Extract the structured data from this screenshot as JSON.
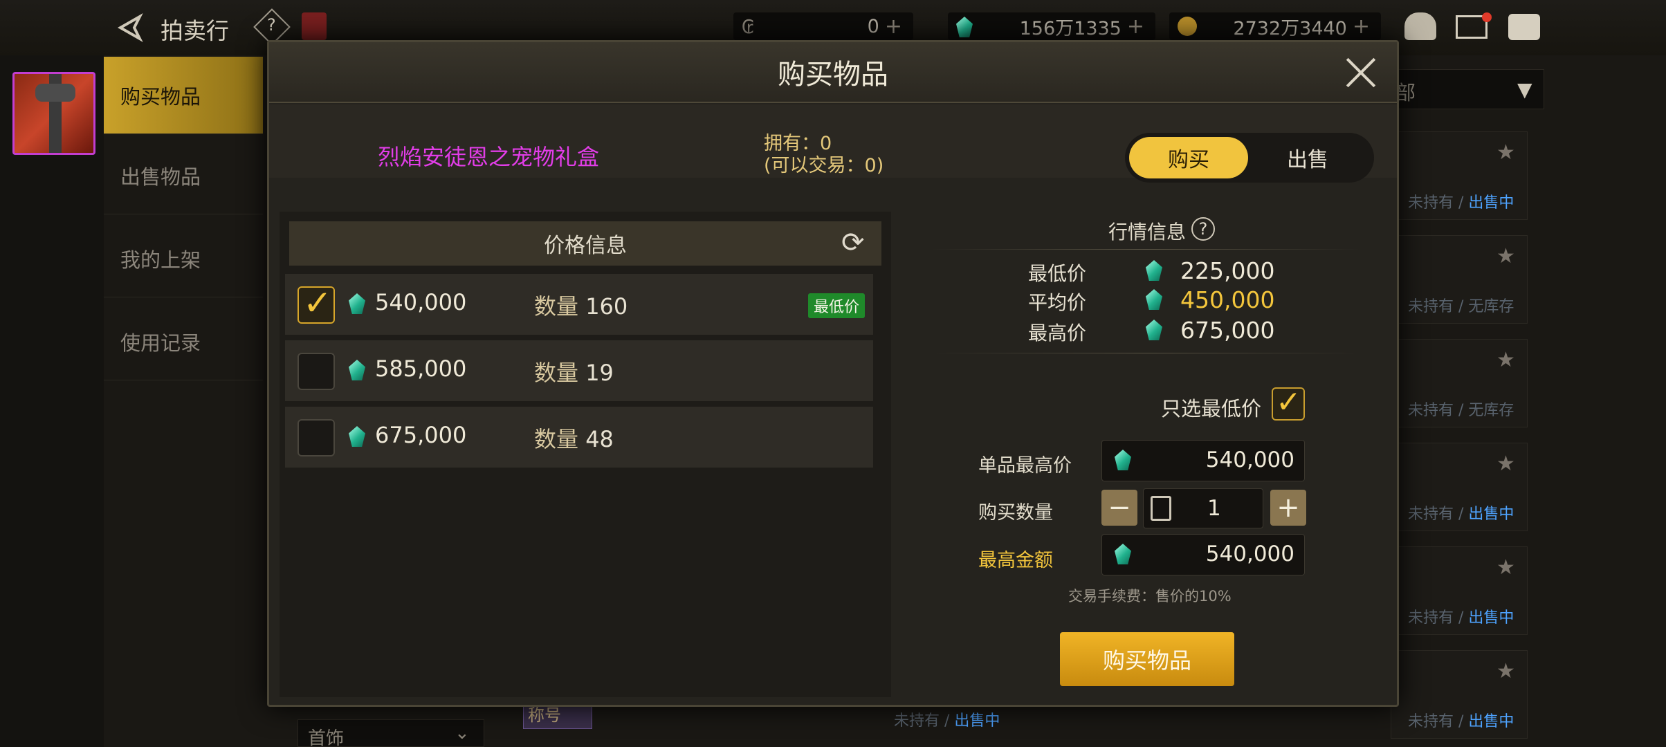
{
  "topbar": {
    "title": "拍卖行",
    "currencies": [
      {
        "icon": "coupon-icon",
        "value": "0"
      },
      {
        "icon": "gem-icon",
        "value": "156万1335"
      },
      {
        "icon": "gold-coin-icon",
        "value": "2732万3440"
      }
    ]
  },
  "sidebar": {
    "items": [
      {
        "label": "购买物品",
        "active": true
      },
      {
        "label": "出售物品",
        "active": false
      },
      {
        "label": "我的上架",
        "active": false
      },
      {
        "label": "使用记录",
        "active": false
      }
    ]
  },
  "background": {
    "filter_label": "部",
    "status": [
      {
        "a": "未持有",
        "b": "出售中"
      },
      {
        "a": "未持有",
        "b": "无库存"
      },
      {
        "a": "未持有",
        "b": "无库存"
      },
      {
        "a": "未持有",
        "b": "出售中"
      },
      {
        "a": "未持有",
        "b": "出售中"
      },
      {
        "a": "未持有",
        "b": "出售中"
      }
    ],
    "bottom_tag": "称号",
    "bottom_status_a": "未持有",
    "bottom_status_b": "出售中",
    "bottom_dropdown": "首饰"
  },
  "modal": {
    "title": "购买物品",
    "item_name": "烈焰安徒恩之宠物礼盒",
    "owned_line": "拥有：0",
    "tradable_line": "(可以交易：0)",
    "toggle": {
      "buy": "购买",
      "sell": "出售",
      "selected": "buy"
    },
    "price_header": "价格信息",
    "listings": [
      {
        "price": "540,000",
        "qty_label": "数量",
        "qty": "160",
        "checked": true,
        "badge": "最低价"
      },
      {
        "price": "585,000",
        "qty_label": "数量",
        "qty": "19",
        "checked": false
      },
      {
        "price": "675,000",
        "qty_label": "数量",
        "qty": "48",
        "checked": false
      }
    ],
    "market": {
      "title": "行情信息",
      "lowest_label": "最低价",
      "lowest_value": "225,000",
      "average_label": "平均价",
      "average_value": "450,000",
      "highest_label": "最高价",
      "highest_value": "675,000"
    },
    "lowest_only_label": "只选最低价",
    "lowest_only_checked": true,
    "unit_max_label": "单品最高价",
    "unit_max_value": "540,000",
    "qty_label": "购买数量",
    "qty_value": "1",
    "max_total_label": "最高金额",
    "max_total_value": "540,000",
    "fee_note": "交易手续费：售价的10%",
    "buy_button": "购买物品"
  },
  "colors": {
    "accent_gold": "#f1c43e",
    "item_name_purple": "#e23de8",
    "average_price": "#f4c63c",
    "status_blue": "#4ea3ff"
  }
}
